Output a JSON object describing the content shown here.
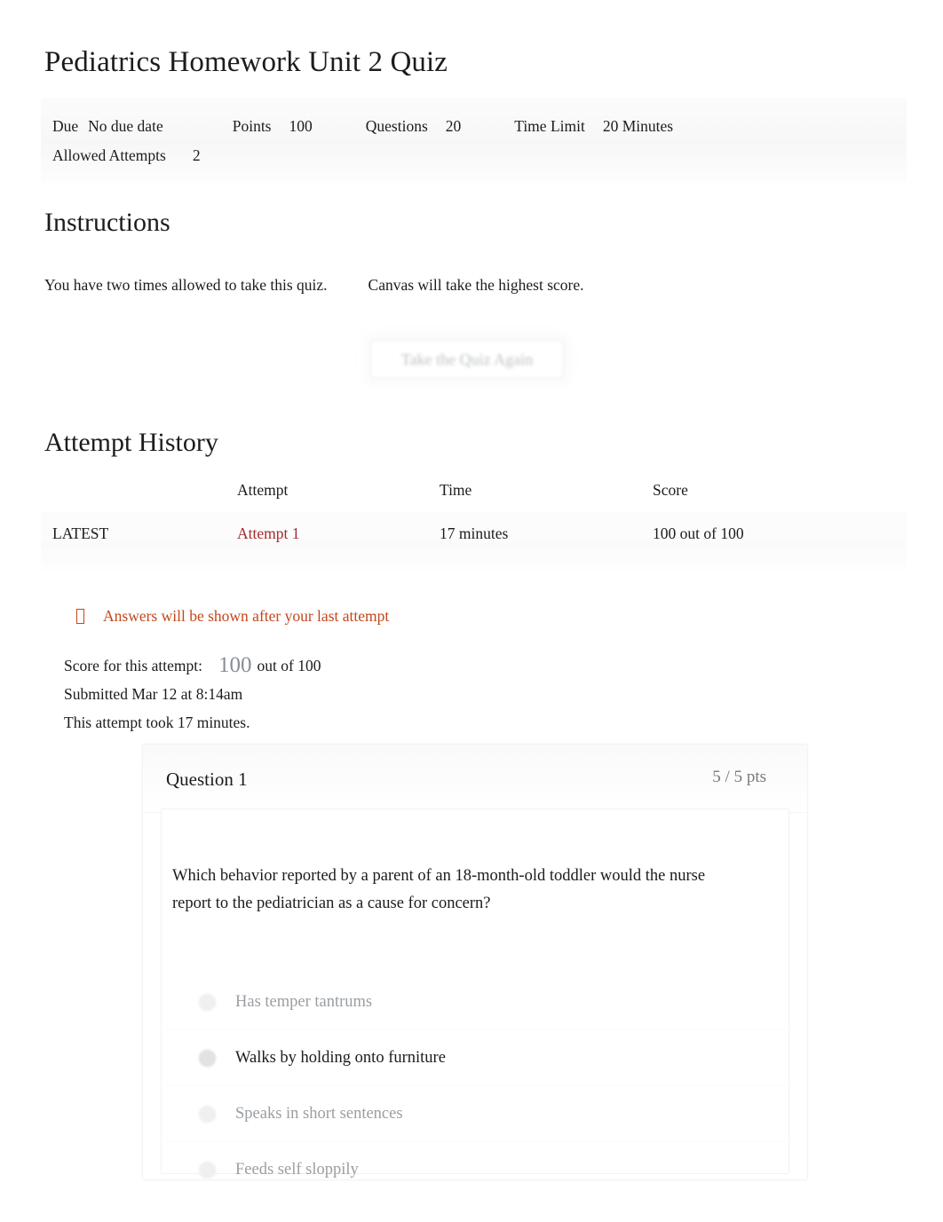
{
  "quiz": {
    "title": "Pediatrics Homework Unit 2 Quiz",
    "meta": {
      "due_label": "Due",
      "due_value": "No due date",
      "points_label": "Points",
      "points_value": "100",
      "questions_label": "Questions",
      "questions_value": "20",
      "time_limit_label": "Time Limit",
      "time_limit_value": "20 Minutes",
      "allowed_attempts_label": "Allowed Attempts",
      "allowed_attempts_value": "2"
    }
  },
  "instructions": {
    "heading": "Instructions",
    "line_part1": "You have two times allowed to take this quiz.",
    "line_part2": "Canvas will take the highest score."
  },
  "actions": {
    "take_quiz_again": "Take the Quiz Again"
  },
  "attempt_history": {
    "heading": "Attempt History",
    "columns": [
      "",
      "Attempt",
      "Time",
      "Score"
    ],
    "rows": [
      {
        "kept": "LATEST",
        "attempt": "Attempt 1",
        "time": "17 minutes",
        "score": "100 out of 100"
      }
    ]
  },
  "notice": {
    "icon": "warning-tofu-icon",
    "text": "Answers will be shown after your last attempt",
    "color": "#c4471c"
  },
  "attempt_summary": {
    "score_label": "Score for this attempt:",
    "score_value": "100",
    "score_out_of": "out of 100",
    "submitted": "Submitted Mar 12 at 8:14am",
    "duration": "This attempt took 17 minutes."
  },
  "question": {
    "number": "Question 1",
    "points": "5 / 5 pts",
    "text": "Which behavior reported by a parent of an 18-month-old toddler would the nurse report to the pediatrician as a cause for concern?",
    "answers": [
      {
        "label": "Has temper tantrums",
        "selected": false
      },
      {
        "label": "Walks by holding onto furniture",
        "selected": true
      },
      {
        "label": "Speaks in short sentences",
        "selected": false
      },
      {
        "label": "Feeds self sloppily",
        "selected": false
      }
    ]
  },
  "colors": {
    "link_red": "#a52a2a",
    "notice_orange": "#c4471c",
    "muted_gray": "#9a9ea2",
    "text": "#1c1c1c"
  }
}
